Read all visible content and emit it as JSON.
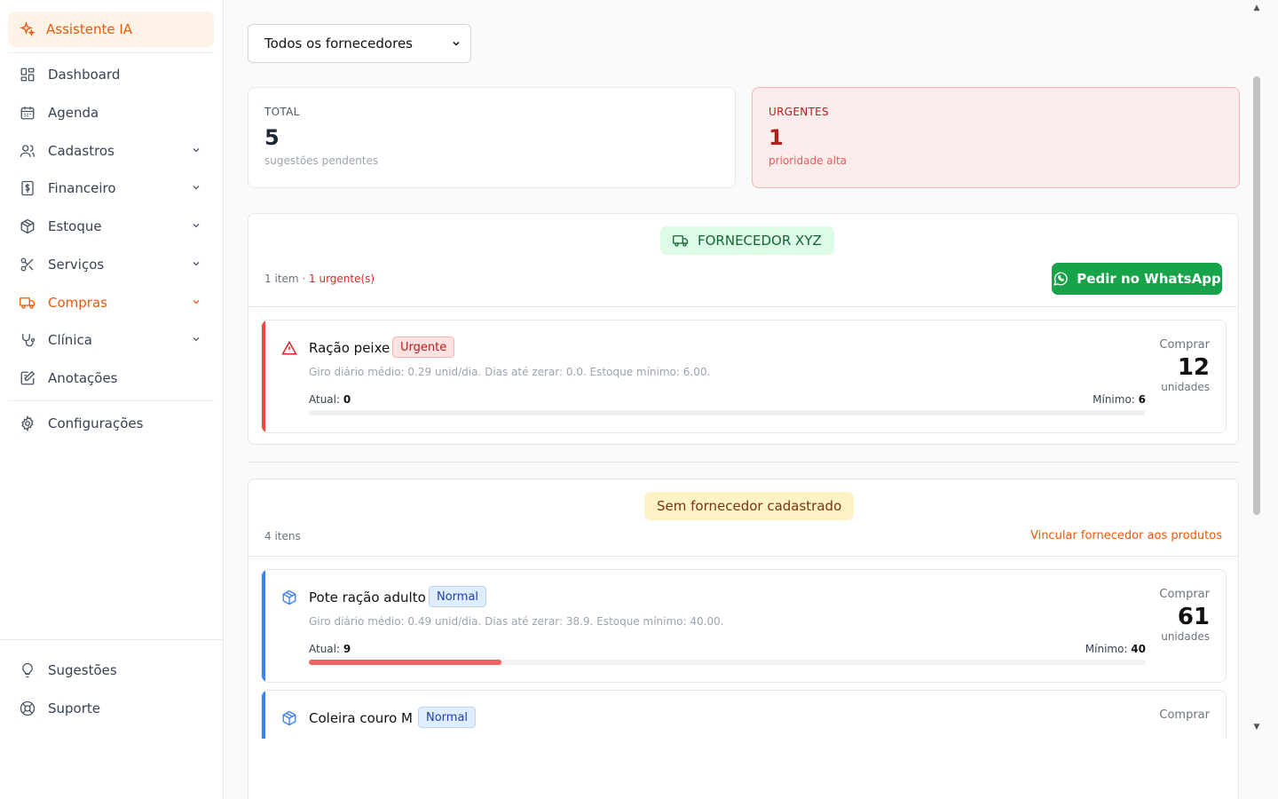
{
  "sidebar": {
    "ai_assistant": "Assistente IA",
    "items": [
      {
        "label": "Dashboard"
      },
      {
        "label": "Agenda"
      },
      {
        "label": "Cadastros"
      },
      {
        "label": "Financeiro"
      },
      {
        "label": "Estoque"
      },
      {
        "label": "Serviços"
      },
      {
        "label": "Compras"
      },
      {
        "label": "Clínica"
      },
      {
        "label": "Anotações"
      }
    ],
    "settings": "Configurações",
    "suggestions": "Sugestões",
    "support": "Suporte"
  },
  "filter": {
    "supplier_select": "Todos os fornecedores"
  },
  "stats": {
    "total": {
      "label": "TOTAL",
      "value": "5",
      "sub": "sugestões pendentes"
    },
    "urgent": {
      "label": "URGENTES",
      "value": "1",
      "sub": "prioridade alta"
    }
  },
  "groups": [
    {
      "title": "FORNECEDOR XYZ",
      "meta": "1 item · ",
      "meta_urgent": "1 urgente(s)",
      "action": "Pedir no WhatsApp",
      "items": [
        {
          "name": "Ração peixe",
          "badge": "Urgente",
          "desc": "Giro diário médio: 0.29 unid/dia. Dias até zerar: 0.0. Estoque mínimo: 6.00.",
          "atual_label": "Atual: ",
          "atual": "0",
          "min_label": "Mínimo: ",
          "min": "6",
          "buy_label": "Comprar",
          "buy_qty": "12",
          "buy_unit": "unidades",
          "fill": 0
        }
      ]
    },
    {
      "title": "Sem fornecedor cadastrado",
      "meta": "4 itens",
      "action": "Vincular fornecedor aos produtos",
      "items": [
        {
          "name": "Pote ração adulto",
          "badge": "Normal",
          "desc": "Giro diário médio: 0.49 unid/dia. Dias até zerar: 38.9. Estoque mínimo: 40.00.",
          "atual_label": "Atual: ",
          "atual": "9",
          "min_label": "Mínimo: ",
          "min": "40",
          "buy_label": "Comprar",
          "buy_qty": "61",
          "buy_unit": "unidades",
          "fill": 0.23
        },
        {
          "name": "Coleira couro M",
          "badge": "Normal",
          "buy_label": "Comprar"
        }
      ]
    }
  ],
  "colors": {
    "accent": "#ea580c",
    "urgent": "#dc2626",
    "normal": "#3b82f6",
    "whatsapp": "#16a34a"
  }
}
